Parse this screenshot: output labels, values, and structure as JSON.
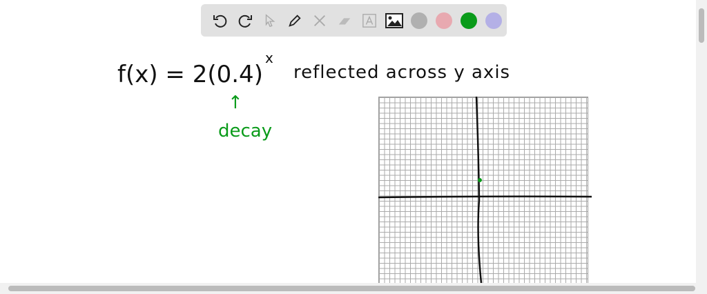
{
  "toolbar": {
    "tools": [
      "undo",
      "redo",
      "select",
      "pen",
      "tools",
      "eraser",
      "text",
      "image"
    ],
    "colors": [
      "#b0b0b0",
      "#e8a9b0",
      "#0a9b1a",
      "#b4b0e6"
    ]
  },
  "board": {
    "equation": "f(x) = 2(0.4)",
    "exponent": "x",
    "note": "reflected across y axis",
    "arrow": "↑",
    "annotation": "decay"
  }
}
